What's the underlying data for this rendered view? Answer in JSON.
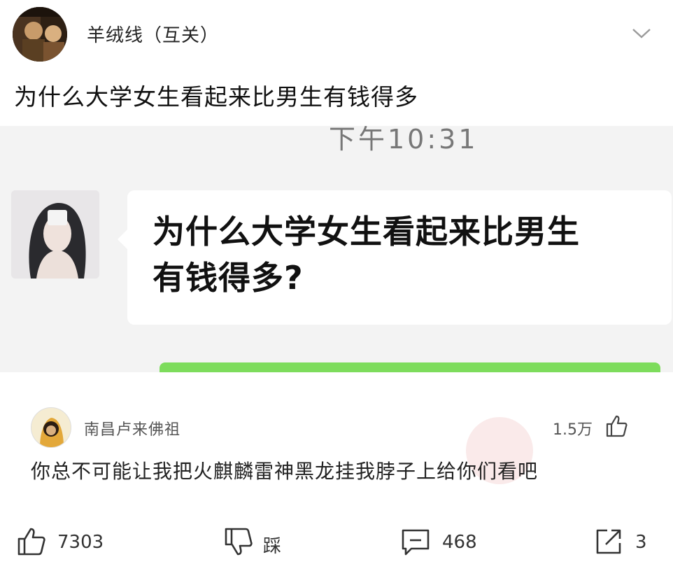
{
  "post": {
    "author": "羊绒线（互关）",
    "title": "为什么大学女生看起来比男生有钱得多"
  },
  "embed": {
    "time": "下午10:31",
    "message_line1": "为什么大学女生看起来比男生",
    "message_line2": "有钱得多?",
    "accent_green": "#7ddc5c"
  },
  "comment": {
    "author": "南昌卢来佛祖",
    "likes": "1.5万",
    "text": "你总不可能让我把火麒麟雷神黑龙挂我脖子上给你们看吧"
  },
  "actions": {
    "like_count": "7303",
    "dislike_label": "踩",
    "comment_count": "468",
    "share_count": "3"
  }
}
